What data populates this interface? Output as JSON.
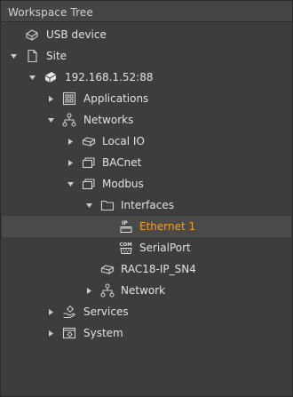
{
  "panel": {
    "title": "Workspace Tree"
  },
  "tree": {
    "usb": {
      "label": "USB device",
      "icon": "usb-device-icon"
    },
    "site": {
      "label": "Site",
      "icon": "document-icon",
      "expanded": true
    },
    "ip": {
      "label": "192.168.1.52:88",
      "icon": "controller-icon",
      "expanded": true
    },
    "applications": {
      "label": "Applications",
      "icon": "applications-icon",
      "expanded": false
    },
    "networks": {
      "label": "Networks",
      "icon": "network-icon",
      "expanded": true
    },
    "local_io": {
      "label": "Local IO",
      "icon": "local-io-icon",
      "expanded": false
    },
    "bacnet": {
      "label": "BACnet",
      "icon": "protocol-icon",
      "expanded": false
    },
    "modbus": {
      "label": "Modbus",
      "icon": "protocol-icon",
      "expanded": true
    },
    "interfaces": {
      "label": "Interfaces",
      "icon": "folder-icon",
      "expanded": true
    },
    "ethernet": {
      "label": "Ethernet 1",
      "icon": "ethernet-ip-icon",
      "badge": "IP",
      "selected": true,
      "color": "#f0a030"
    },
    "serial": {
      "label": "SerialPort",
      "icon": "com-port-icon",
      "badge": "COM"
    },
    "rac": {
      "label": "RAC18-IP_SN4",
      "icon": "device-icon"
    },
    "network": {
      "label": "Network",
      "icon": "network-icon",
      "expanded": false
    },
    "services": {
      "label": "Services",
      "icon": "services-icon",
      "expanded": false
    },
    "system": {
      "label": "System",
      "icon": "system-icon",
      "expanded": false
    }
  }
}
